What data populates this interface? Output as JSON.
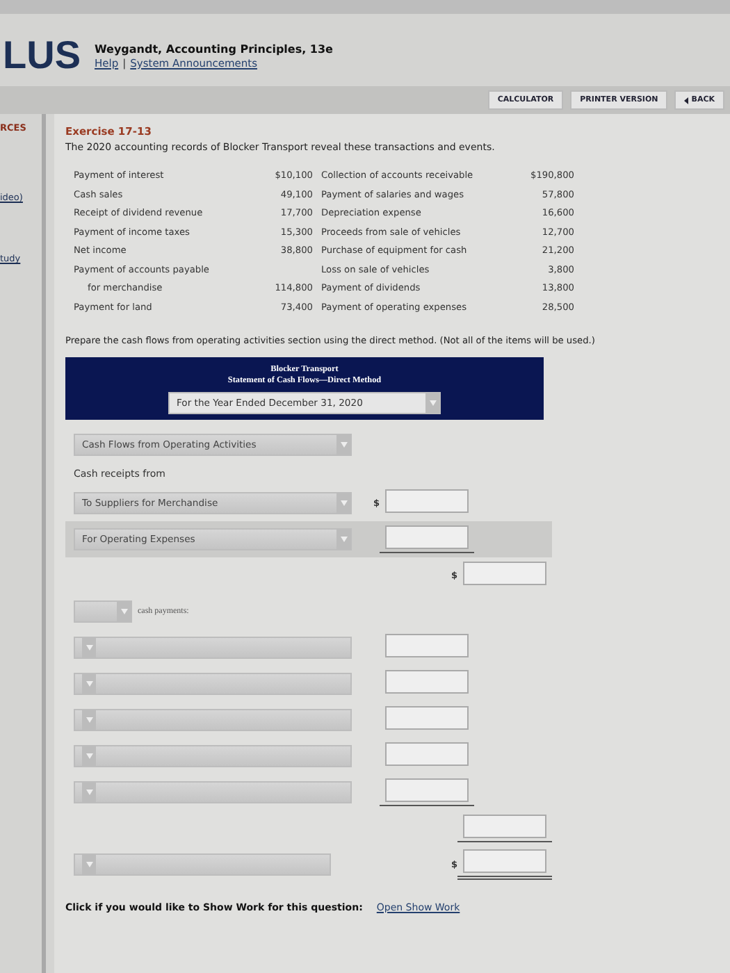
{
  "header": {
    "logo": "LUS",
    "book_title": "Weygandt, Accounting Principles, 13e",
    "links": [
      "Help",
      "System Announcements"
    ],
    "separator": "|"
  },
  "toolbar": {
    "buttons": [
      {
        "label": "CALCULATOR",
        "kind": "plain"
      },
      {
        "label": "PRINTER VERSION",
        "kind": "plain"
      },
      {
        "label": "BACK",
        "kind": "back"
      }
    ]
  },
  "sidebar": {
    "items": [
      {
        "label": "RCES",
        "kind": "heading"
      },
      {
        "label": "ideo)",
        "kind": "link"
      },
      {
        "label": "tudy",
        "kind": "link"
      }
    ]
  },
  "exercise": {
    "title": "Exercise 17-13",
    "intro": "The 2020 accounting records of Blocker Transport reveal these transactions and events.",
    "transactions": [
      {
        "left_label": "Payment of interest",
        "left_amount": "$10,100",
        "left_indented": false,
        "right_label": "Collection of accounts receivable",
        "right_amount": "$190,800"
      },
      {
        "left_label": "Cash sales",
        "left_amount": "49,100",
        "left_indented": false,
        "right_label": "Payment of salaries and wages",
        "right_amount": "57,800"
      },
      {
        "left_label": "Receipt of dividend revenue",
        "left_amount": "17,700",
        "left_indented": false,
        "right_label": "Depreciation expense",
        "right_amount": "16,600"
      },
      {
        "left_label": "Payment of income taxes",
        "left_amount": "15,300",
        "left_indented": false,
        "right_label": "Proceeds from sale of vehicles",
        "right_amount": "12,700"
      },
      {
        "left_label": "Net income",
        "left_amount": "38,800",
        "left_indented": false,
        "right_label": "Purchase of equipment for cash",
        "right_amount": "21,200"
      },
      {
        "left_label": "Payment of accounts payable",
        "left_indented": false,
        "right_label": "Loss on sale of vehicles",
        "right_amount": "3,800"
      },
      {
        "left_label": "for merchandise",
        "left_amount": "114,800",
        "left_indented": true,
        "right_label": "Payment of dividends",
        "right_amount": "13,800"
      },
      {
        "left_label": "Payment for land",
        "left_amount": "73,400",
        "left_indented": false,
        "right_label": "Payment of operating expenses",
        "right_amount": "28,500"
      }
    ],
    "instruction": "Prepare the cash flows from operating activities section using the direct method. (Not all of the items will be used.)"
  },
  "statement": {
    "company": "Blocker Transport",
    "title": "Statement of Cash Flows—Direct Method",
    "period": "For the Year Ended December 31, 2020",
    "lines": [
      {
        "kind": "select",
        "value": "Cash Flows from Operating Activities"
      },
      {
        "kind": "text",
        "text": "Cash receipts from"
      },
      {
        "kind": "entry",
        "value": "To Suppliers for Merchandise",
        "dollar": "$",
        "underlined": false,
        "shaded": false
      },
      {
        "kind": "entry",
        "value": "For Operating Expenses",
        "underlined": true,
        "shaded": true
      },
      {
        "kind": "total",
        "dollar": "$",
        "underlined": false
      },
      {
        "kind": "small-select",
        "text": "cash payments:"
      },
      {
        "kind": "entry",
        "underlined": false,
        "shaded": false
      },
      {
        "kind": "entry",
        "underlined": false,
        "shaded": false
      },
      {
        "kind": "entry",
        "underlined": false,
        "shaded": false
      },
      {
        "kind": "entry",
        "underlined": false,
        "shaded": false
      },
      {
        "kind": "entry",
        "underlined": true,
        "shaded": false
      },
      {
        "kind": "total",
        "underlined": true
      },
      {
        "kind": "grand-total",
        "dollar": "$",
        "double_underlined": true
      }
    ]
  },
  "footer": {
    "prompt": "Click if you would like to Show Work for this question:",
    "link": "Open Show Work"
  }
}
